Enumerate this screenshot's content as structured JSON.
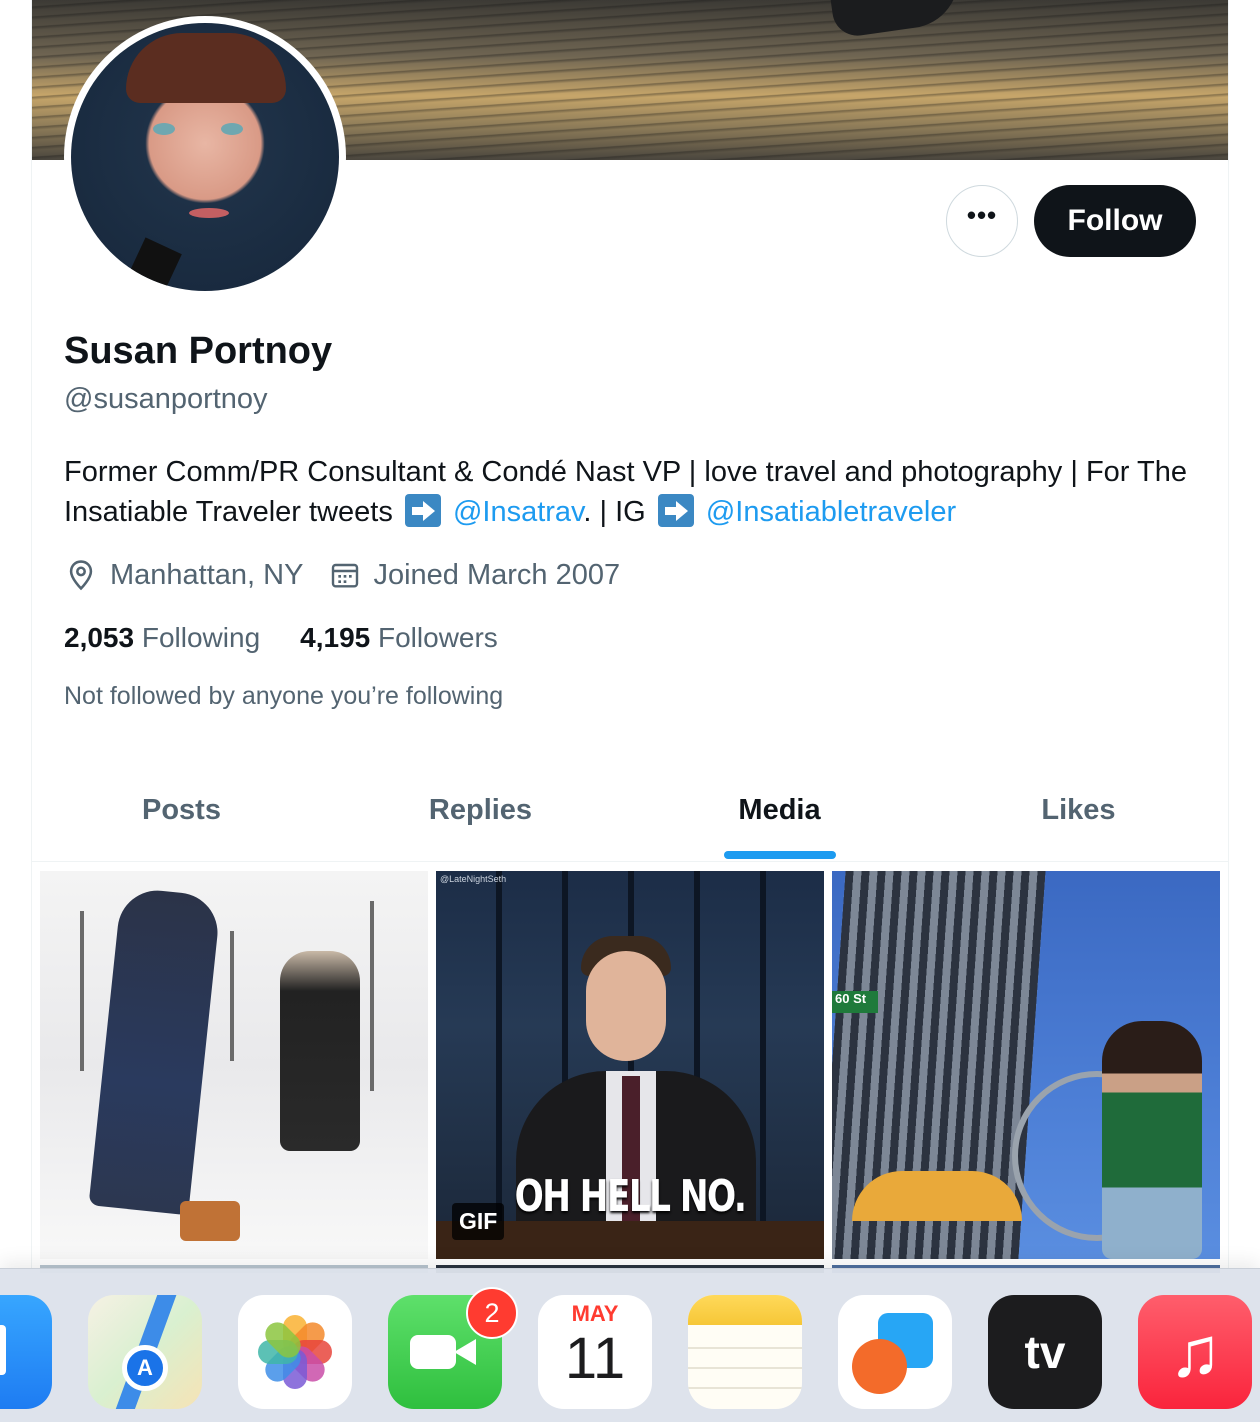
{
  "profile": {
    "name": "Susan Portnoy",
    "handle": "@susanportnoy",
    "bio_part1": "Former Comm/PR Consultant & Condé Nast VP | love travel and photography | For The Insatiable Traveler tweets ",
    "bio_link1": "@Insatrav",
    "bio_part2": ". | IG ",
    "bio_link2": "@Insatiabletraveler",
    "location": "Manhattan, NY",
    "joined": "Joined March 2007",
    "following_count": "2,053",
    "following_label": "Following",
    "followers_count": "4,195",
    "followers_label": "Followers",
    "not_followed_text": "Not followed by anyone you’re following"
  },
  "actions": {
    "more_label": "•••",
    "follow_label": "Follow"
  },
  "tabs": [
    {
      "label": "Posts",
      "active": false
    },
    {
      "label": "Replies",
      "active": false
    },
    {
      "label": "Media",
      "active": true
    },
    {
      "label": "Likes",
      "active": false
    }
  ],
  "media": {
    "gif_caption": "OH HELL NO.",
    "gif_badge": "GIF",
    "gif_watermark": "@LateNightSeth",
    "street_sign": "60 St"
  },
  "dock": {
    "facetime_badge": "2",
    "calendar_month": "MAY",
    "calendar_day": "11",
    "tv_label": "tv",
    "music_glyph": "♫",
    "maps_glyph": "A"
  },
  "colors": {
    "accent": "#1d9bf0",
    "text_primary": "#0f1419",
    "text_secondary": "#536471",
    "follow_bg": "#0f1419"
  }
}
